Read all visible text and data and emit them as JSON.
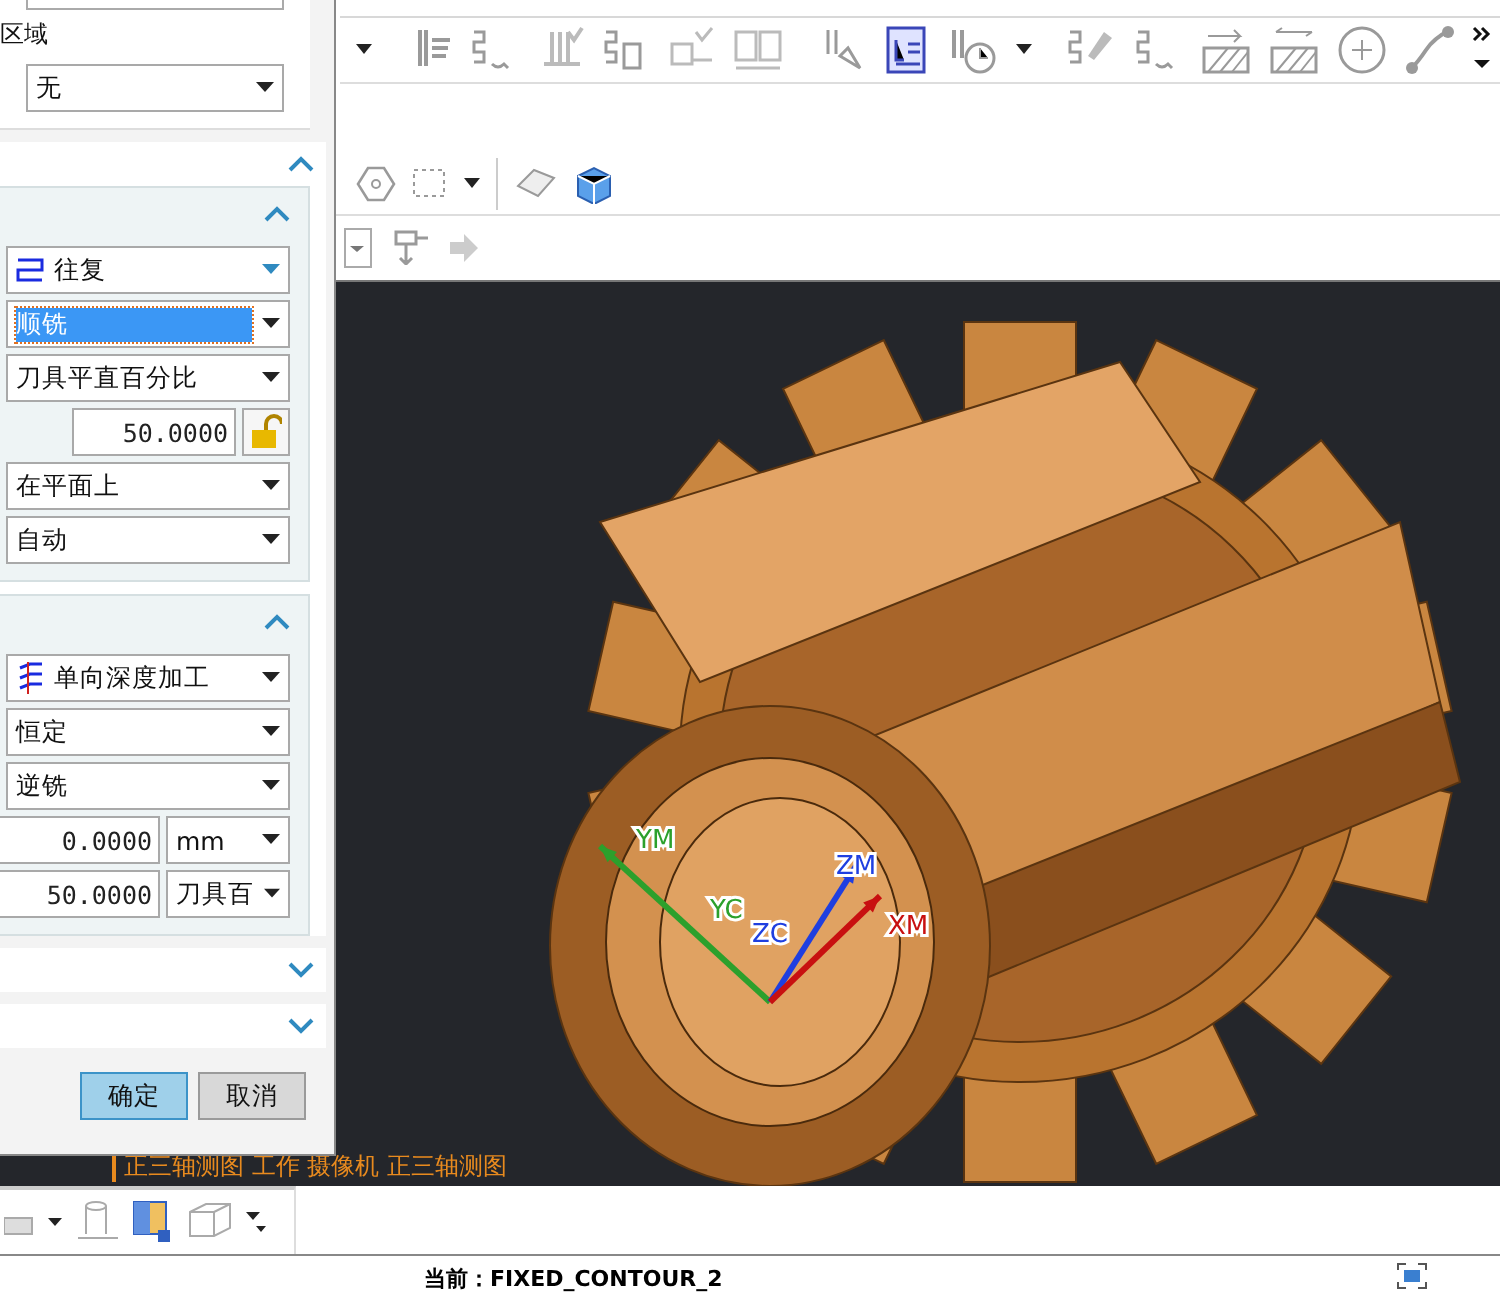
{
  "dialog": {
    "region_label": "区域",
    "region_select": "无",
    "sections": [
      {
        "expanded": true,
        "groups": [
          {
            "expanded": true,
            "fields": [
              {
                "kind": "pattern",
                "value": "往复",
                "focused": false
              },
              {
                "kind": "select",
                "value": "顺铣",
                "focused": true
              },
              {
                "kind": "select",
                "value": "刀具平直百分比",
                "focused": false
              },
              {
                "kind": "locknumber",
                "value": "50.0000",
                "locked": false,
                "focused": false
              },
              {
                "kind": "select",
                "value": "在平面上",
                "focused": false
              },
              {
                "kind": "select",
                "value": "自动",
                "focused": false
              }
            ]
          },
          {
            "expanded": true,
            "fields": [
              {
                "kind": "depth",
                "value": "单向深度加工",
                "focused": false
              },
              {
                "kind": "select",
                "value": "恒定",
                "focused": false
              },
              {
                "kind": "select",
                "value": "逆铣",
                "focused": false
              },
              {
                "kind": "unitnumber",
                "value": "0.0000",
                "unit": "mm",
                "focused": false
              },
              {
                "kind": "unitnumber",
                "value": "50.0000",
                "unit": "刀具百",
                "focused": false
              }
            ]
          }
        ]
      },
      {
        "expanded": false
      },
      {
        "expanded": false
      }
    ],
    "buttons": [
      {
        "label": "确定",
        "default": true
      },
      {
        "label": "取消",
        "default": false
      }
    ]
  },
  "viewport": {
    "view_label": "正三轴测图 工作 摄像机 正三轴测图",
    "axes": [
      {
        "label": "YM",
        "color": "#2ca02c"
      },
      {
        "label": "YC",
        "color": "#2ca02c"
      },
      {
        "label": "ZM",
        "color": "#1f3fe0"
      },
      {
        "label": "ZC",
        "color": "#1f3fe0"
      },
      {
        "label": "XM",
        "color": "#c81010"
      }
    ]
  },
  "status_bar": {
    "text": "当前：FIXED_CONTOUR_2"
  }
}
